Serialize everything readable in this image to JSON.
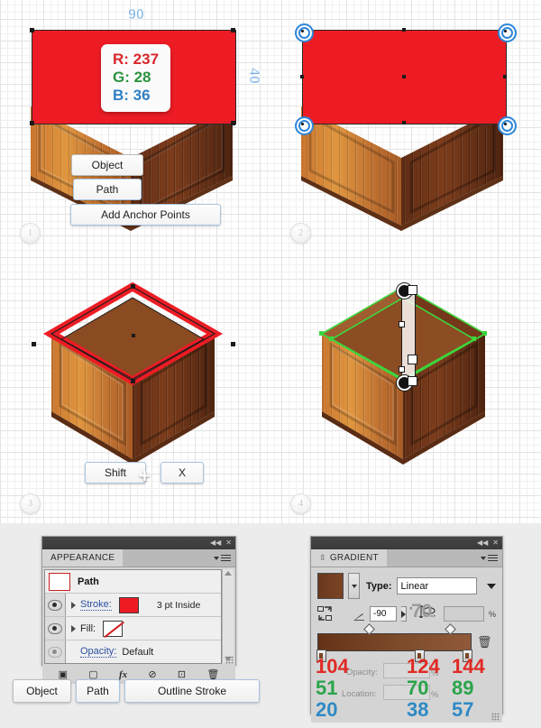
{
  "canvas": {
    "steps": [
      {
        "id": "1",
        "label": "1"
      },
      {
        "id": "2",
        "label": "2"
      },
      {
        "id": "3",
        "label": "3"
      },
      {
        "id": "4",
        "label": "4"
      }
    ],
    "step1": {
      "dim_width": "90",
      "dim_height": "40",
      "rgb_card": {
        "r": "R: 237",
        "g": "G: 28",
        "b": "B: 36"
      },
      "menu": [
        "Object",
        "Path",
        "Add Anchor Points"
      ]
    },
    "step3": {
      "keys": {
        "modifier": "Shift",
        "plus": "+",
        "letter": "X"
      }
    },
    "colors": {
      "red_fill": "#ED1C24",
      "selection_blue": "#2F86D8",
      "path_green": "#3CD63C",
      "dim_label": "#7FB4E3"
    }
  },
  "appearance_panel": {
    "tab_title": "APPEARANCE",
    "object_name": "Path",
    "rows": [
      {
        "label": "Stroke:",
        "value": "3 pt  Inside",
        "swatch": "red"
      },
      {
        "label": "Fill:",
        "value": "",
        "swatch": "none"
      },
      {
        "label": "Opacity:",
        "value": "Default",
        "swatch": null
      }
    ],
    "footer_icons": [
      "add-new-stroke-icon",
      "add-new-fill-icon",
      "add-new-effect-icon",
      "clear-appearance-icon",
      "duplicate-item-icon",
      "delete-item-icon"
    ]
  },
  "gradient_panel": {
    "tab_title": "GRADIENT",
    "type_label": "Type:",
    "type_value": "Linear",
    "angle_value": "-90",
    "angle_unit": "°",
    "aspect_value": "",
    "aspect_unit": "%",
    "opacity_label": "Opacity:",
    "opacity_value": "",
    "opacity_unit": "%",
    "location_label": "Location:",
    "location_value": "",
    "location_unit": "%",
    "annotation_midpoint": "70",
    "stops": [
      {
        "r": "104",
        "g": "51",
        "b": "20",
        "location": 0
      },
      {
        "r": "124",
        "g": "70",
        "b": "38",
        "location": 60
      },
      {
        "r": "144",
        "g": "89",
        "b": "57",
        "location": 100
      }
    ]
  },
  "bottom_buttons": [
    {
      "label": "Object",
      "style": "gray"
    },
    {
      "label": "Path",
      "style": "blue"
    },
    {
      "label": "Outline Stroke",
      "style": "blue"
    }
  ]
}
